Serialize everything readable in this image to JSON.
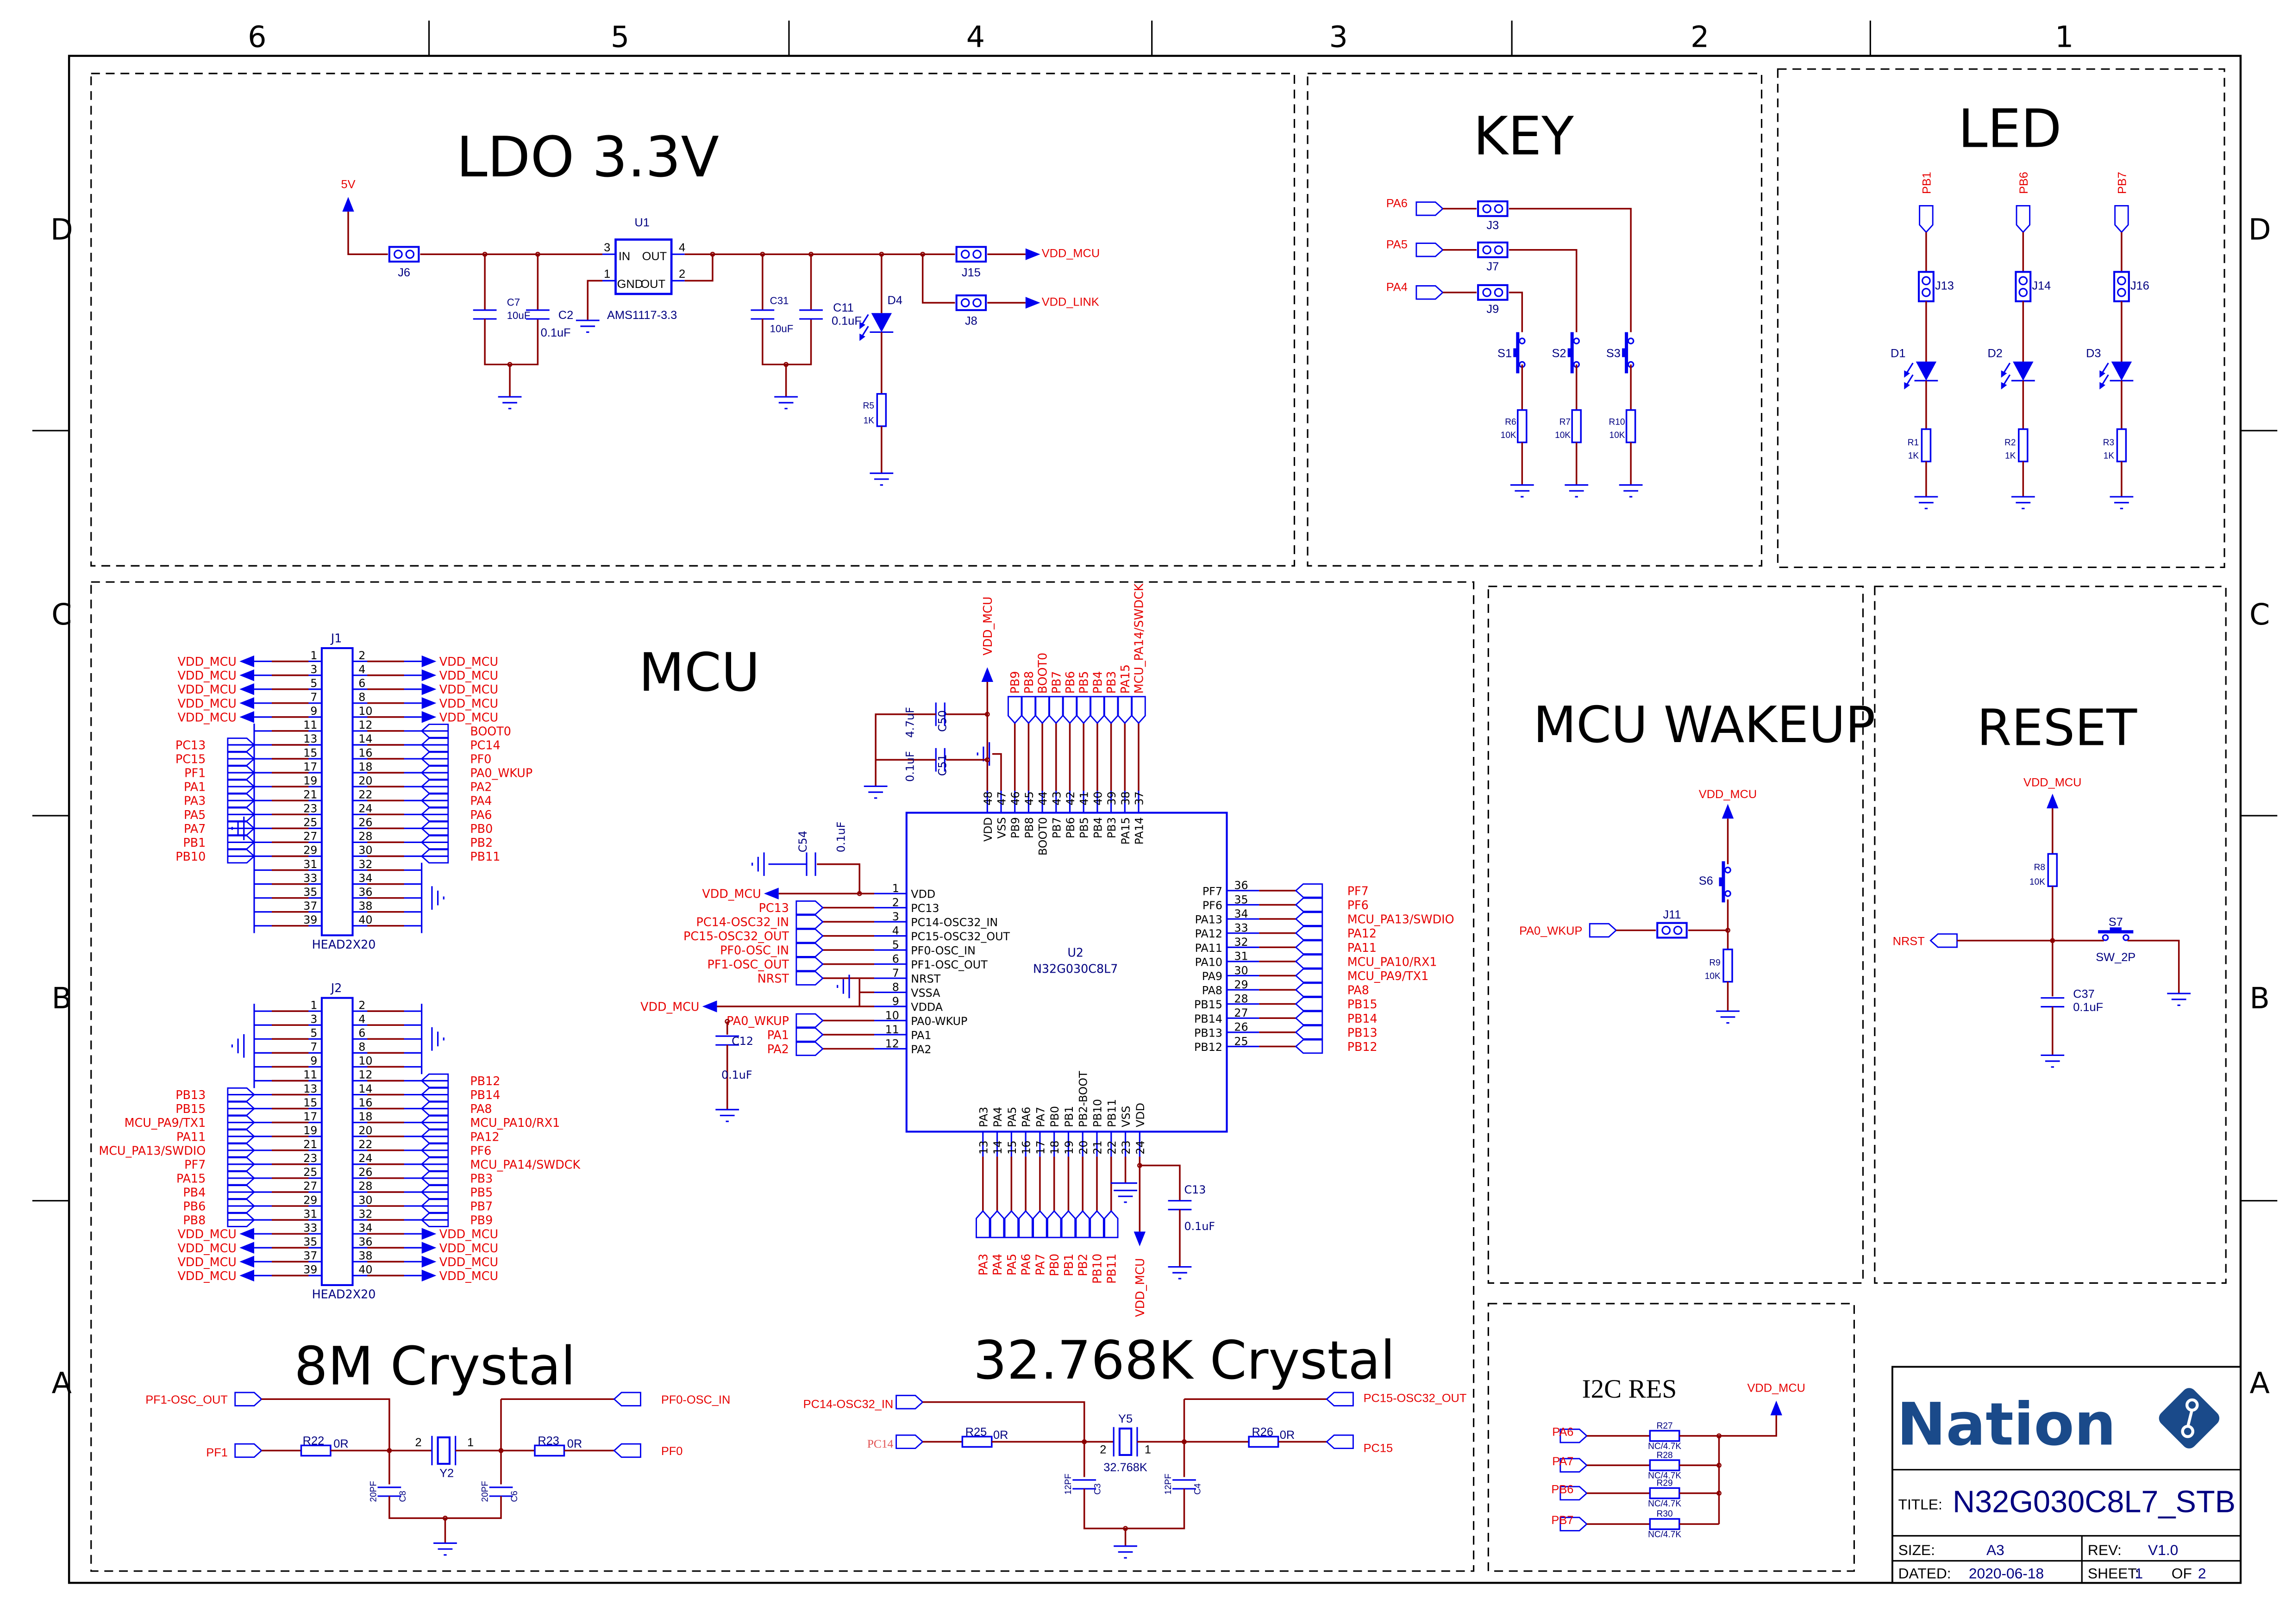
{
  "frame": {
    "columns": [
      "6",
      "5",
      "4",
      "3",
      "2",
      "1"
    ],
    "rows": [
      "D",
      "C",
      "B",
      "A"
    ]
  },
  "colors": {
    "wire": "#8b0000",
    "symbol": "#0000ee",
    "net_label": "#e60000",
    "component_text": "#000080",
    "logo": "#1a4a8a"
  },
  "ldo": {
    "title": "LDO 3.3V",
    "net_5v": "5V",
    "j6": "J6",
    "u1": {
      "ref": "U1",
      "part": "AMS1117-3.3",
      "pin_in": "IN",
      "pin_out": "OUT",
      "pin_gnd": "GND",
      "pin_out2": "OUT",
      "pin_nums": [
        "3",
        "4",
        "1",
        "2"
      ]
    },
    "c7": {
      "ref": "C7",
      "value": "10uF"
    },
    "c2": {
      "ref": "C2",
      "value": "0.1uF"
    },
    "c31": {
      "ref": "C31",
      "value": "10uF"
    },
    "c11": {
      "ref": "C11",
      "value": "0.1uF"
    },
    "d4": "D4",
    "r5": {
      "ref": "R5",
      "value": "1K"
    },
    "j15": "J15",
    "j8": "J8",
    "vdd_mcu": "VDD_MCU",
    "vdd_link": "VDD_LINK"
  },
  "key": {
    "title": "KEY",
    "rows": [
      {
        "net": "PA6",
        "jumper": "J3"
      },
      {
        "net": "PA5",
        "jumper": "J7"
      },
      {
        "net": "PA4",
        "jumper": "J9"
      }
    ],
    "switches": [
      {
        "ref": "S1",
        "res": "R6",
        "value": "10K"
      },
      {
        "ref": "S2",
        "res": "R7",
        "value": "10K"
      },
      {
        "ref": "S3",
        "res": "R10",
        "value": "10K"
      }
    ]
  },
  "led": {
    "title": "LED",
    "channels": [
      {
        "net": "PB1",
        "jumper": "J13",
        "diode": "D1",
        "res": "R1",
        "value": "1K"
      },
      {
        "net": "PB6",
        "jumper": "J14",
        "diode": "D2",
        "res": "R2",
        "value": "1K"
      },
      {
        "net": "PB7",
        "jumper": "J16",
        "diode": "D3",
        "res": "R3",
        "value": "1K"
      }
    ]
  },
  "mcu": {
    "title": "MCU",
    "u2": {
      "ref": "U2",
      "part": "N32G030C8L7"
    },
    "left_pins": [
      {
        "num": "1",
        "name": "VDD",
        "net": "VDD_MCU"
      },
      {
        "num": "2",
        "name": "PC13",
        "net": "PC13"
      },
      {
        "num": "3",
        "name": "PC14-OSC32_IN",
        "net": "PC14-OSC32_IN"
      },
      {
        "num": "4",
        "name": "PC15-OSC32_OUT",
        "net": "PC15-OSC32_OUT"
      },
      {
        "num": "5",
        "name": "PF0-OSC_IN",
        "net": "PF0-OSC_IN"
      },
      {
        "num": "6",
        "name": "PF1-OSC_OUT",
        "net": "PF1-OSC_OUT"
      },
      {
        "num": "7",
        "name": "NRST",
        "net": "NRST"
      },
      {
        "num": "8",
        "name": "VSSA",
        "net": ""
      },
      {
        "num": "9",
        "name": "VDDA",
        "net": "VDD_MCU"
      },
      {
        "num": "10",
        "name": "PA0-WKUP",
        "net": "PA0_WKUP"
      },
      {
        "num": "11",
        "name": "PA1",
        "net": "PA1"
      },
      {
        "num": "12",
        "name": "PA2",
        "net": "PA2"
      }
    ],
    "right_pins": [
      {
        "num": "36",
        "name": "PF7",
        "net": "PF7"
      },
      {
        "num": "35",
        "name": "PF6",
        "net": "PF6"
      },
      {
        "num": "34",
        "name": "PA13",
        "net": "MCU_PA13/SWDIO"
      },
      {
        "num": "33",
        "name": "PA12",
        "net": "PA12"
      },
      {
        "num": "32",
        "name": "PA11",
        "net": "PA11"
      },
      {
        "num": "31",
        "name": "PA10",
        "net": "MCU_PA10/RX1"
      },
      {
        "num": "30",
        "name": "PA9",
        "net": "MCU_PA9/TX1"
      },
      {
        "num": "29",
        "name": "PA8",
        "net": "PA8"
      },
      {
        "num": "28",
        "name": "PB15",
        "net": "PB15"
      },
      {
        "num": "27",
        "name": "PB14",
        "net": "PB14"
      },
      {
        "num": "26",
        "name": "PB13",
        "net": "PB13"
      },
      {
        "num": "25",
        "name": "PB12",
        "net": "PB12"
      }
    ],
    "top_pins": [
      {
        "num": "48",
        "name": "VDD",
        "net": "VDD_MCU"
      },
      {
        "num": "47",
        "name": "VSS",
        "net": ""
      },
      {
        "num": "46",
        "name": "PB9",
        "net": "PB9"
      },
      {
        "num": "45",
        "name": "PB8",
        "net": "PB8"
      },
      {
        "num": "44",
        "name": "BOOT0",
        "net": "BOOT0"
      },
      {
        "num": "43",
        "name": "PB7",
        "net": "PB7"
      },
      {
        "num": "42",
        "name": "PB6",
        "net": "PB6"
      },
      {
        "num": "41",
        "name": "PB5",
        "net": "PB5"
      },
      {
        "num": "40",
        "name": "PB4",
        "net": "PB4"
      },
      {
        "num": "39",
        "name": "PB3",
        "net": "PB3"
      },
      {
        "num": "38",
        "name": "PA15",
        "net": "PA15"
      },
      {
        "num": "37",
        "name": "PA14",
        "net": "MCU_PA14/SWDCK"
      }
    ],
    "bottom_pins": [
      {
        "num": "13",
        "name": "PA3",
        "net": "PA3"
      },
      {
        "num": "14",
        "name": "PA4",
        "net": "PA4"
      },
      {
        "num": "15",
        "name": "PA5",
        "net": "PA5"
      },
      {
        "num": "16",
        "name": "PA6",
        "net": "PA6"
      },
      {
        "num": "17",
        "name": "PA7",
        "net": "PA7"
      },
      {
        "num": "18",
        "name": "PB0",
        "net": "PB0"
      },
      {
        "num": "19",
        "name": "PB1",
        "net": "PB1"
      },
      {
        "num": "20",
        "name": "PB2-BOOT",
        "net": "PB2"
      },
      {
        "num": "21",
        "name": "PB10",
        "net": "PB10"
      },
      {
        "num": "22",
        "name": "PB11",
        "net": "PB11"
      },
      {
        "num": "23",
        "name": "VSS",
        "net": ""
      },
      {
        "num": "24",
        "name": "VDD",
        "net": "VDD_MCU"
      }
    ],
    "c50": {
      "ref": "C50",
      "value": "4.7uF"
    },
    "c51": {
      "ref": "C51",
      "value": "0.1uF"
    },
    "c54": {
      "ref": "C54",
      "value": "0.1uF"
    },
    "c12": {
      "ref": "C12",
      "value": "0.1uF"
    },
    "c13": {
      "ref": "C13",
      "value": "0.1uF"
    }
  },
  "headers": [
    {
      "ref": "J1",
      "part": "HEAD2X20",
      "left_pin_numbers": [
        "1",
        "3",
        "5",
        "7",
        "9",
        "11",
        "13",
        "15",
        "17",
        "19",
        "21",
        "23",
        "25",
        "27",
        "29",
        "31",
        "33",
        "35",
        "37",
        "39"
      ],
      "right_pin_numbers": [
        "2",
        "4",
        "6",
        "8",
        "10",
        "12",
        "14",
        "16",
        "18",
        "20",
        "22",
        "24",
        "26",
        "28",
        "30",
        "32",
        "34",
        "36",
        "38",
        "40"
      ],
      "left_nets": [
        "VDD_MCU",
        "VDD_MCU",
        "VDD_MCU",
        "VDD_MCU",
        "VDD_MCU",
        "",
        "PC13",
        "PC15",
        "PF1",
        "PA1",
        "PA3",
        "PA5",
        "PA7",
        "PB1",
        "PB10",
        "",
        "",
        "",
        "",
        ""
      ],
      "right_nets": [
        "VDD_MCU",
        "VDD_MCU",
        "VDD_MCU",
        "VDD_MCU",
        "VDD_MCU",
        "BOOT0",
        "PC14",
        "PF0",
        "PA0_WKUP",
        "PA2",
        "PA4",
        "PA6",
        "PB0",
        "PB2",
        "PB11",
        "",
        "",
        "",
        "",
        ""
      ]
    },
    {
      "ref": "J2",
      "part": "HEAD2X20",
      "left_pin_numbers": [
        "1",
        "3",
        "5",
        "7",
        "9",
        "11",
        "13",
        "15",
        "17",
        "19",
        "21",
        "23",
        "25",
        "27",
        "29",
        "31",
        "33",
        "35",
        "37",
        "39"
      ],
      "right_pin_numbers": [
        "2",
        "4",
        "6",
        "8",
        "10",
        "12",
        "14",
        "16",
        "18",
        "20",
        "22",
        "24",
        "26",
        "28",
        "30",
        "32",
        "34",
        "36",
        "38",
        "40"
      ],
      "left_nets": [
        "",
        "",
        "",
        "",
        "",
        "",
        "PB13",
        "PB15",
        "MCU_PA9/TX1",
        "PA11",
        "MCU_PA13/SWDIO",
        "PF7",
        "PA15",
        "PB4",
        "PB6",
        "PB8",
        "VDD_MCU",
        "VDD_MCU",
        "VDD_MCU",
        "VDD_MCU"
      ],
      "right_nets": [
        "",
        "",
        "",
        "",
        "",
        "PB12",
        "PB14",
        "PA8",
        "MCU_PA10/RX1",
        "PA12",
        "PF6",
        "MCU_PA14/SWDCK",
        "PB3",
        "PB5",
        "PB7",
        "PB9",
        "VDD_MCU",
        "VDD_MCU",
        "VDD_MCU",
        "VDD_MCU"
      ]
    }
  ],
  "wakeup": {
    "title": "MCU WAKEUP",
    "vdd": "VDD_MCU",
    "switch": "S6",
    "jumper": "J11",
    "net": "PA0_WKUP",
    "res": "R9",
    "value": "10K"
  },
  "reset": {
    "title": "RESET",
    "vdd": "VDD_MCU",
    "res": "R8",
    "res_value": "10K",
    "net": "NRST",
    "switch": "S7",
    "switch_part": "SW_2P",
    "cap": "C37",
    "cap_value": "0.1uF"
  },
  "crystal_8m": {
    "title": "8M Crystal",
    "net_out": "PF1-OSC_OUT",
    "net_in": "PF0-OSC_IN",
    "net_pf1": "PF1",
    "net_pf0": "PF0",
    "r22": {
      "ref": "R22",
      "value": "0R"
    },
    "r23": {
      "ref": "R23",
      "value": "0R"
    },
    "y2": "Y2",
    "pin2": "2",
    "pin1": "1",
    "c8": {
      "ref": "C8",
      "value": "20PF"
    },
    "c6": {
      "ref": "C6",
      "value": "20PF"
    }
  },
  "crystal_32k": {
    "title": "32.768K Crystal",
    "net_in": "PC14-OSC32_IN",
    "net_out": "PC15-OSC32_OUT",
    "net_pc14": "PC14",
    "net_pc15": "PC15",
    "r25": {
      "ref": "R25",
      "value": "0R"
    },
    "r26": {
      "ref": "R26",
      "value": "0R"
    },
    "y5": "Y5",
    "y5_value": "32.768K",
    "pin2": "2",
    "pin1": "1",
    "c3": {
      "ref": "C3",
      "value": "12PF"
    },
    "c4": {
      "ref": "C4",
      "value": "12PF"
    }
  },
  "i2c": {
    "title": "I2C RES",
    "vdd": "VDD_MCU",
    "rows": [
      {
        "net": "PA6",
        "ref": "R27",
        "value": "NC/4.7K"
      },
      {
        "net": "PA7",
        "ref": "R28",
        "value": "NC/4.7K"
      },
      {
        "net": "PB6",
        "ref": "R29",
        "value": "NC/4.7K"
      },
      {
        "net": "PB7",
        "ref": "R30",
        "value": "NC/4.7K"
      }
    ]
  },
  "title_block": {
    "logo_text": "Nation",
    "title_label": "TITLE:",
    "title": "N32G030C8L7_STB",
    "size_label": "SIZE:",
    "size": "A3",
    "rev_label": "REV:",
    "rev": "V1.0",
    "dated_label": "DATED:",
    "date": "2020-06-18",
    "sheet_label": "SHEET:",
    "sheet": "1",
    "of_label": "OF",
    "sheets": "2"
  }
}
